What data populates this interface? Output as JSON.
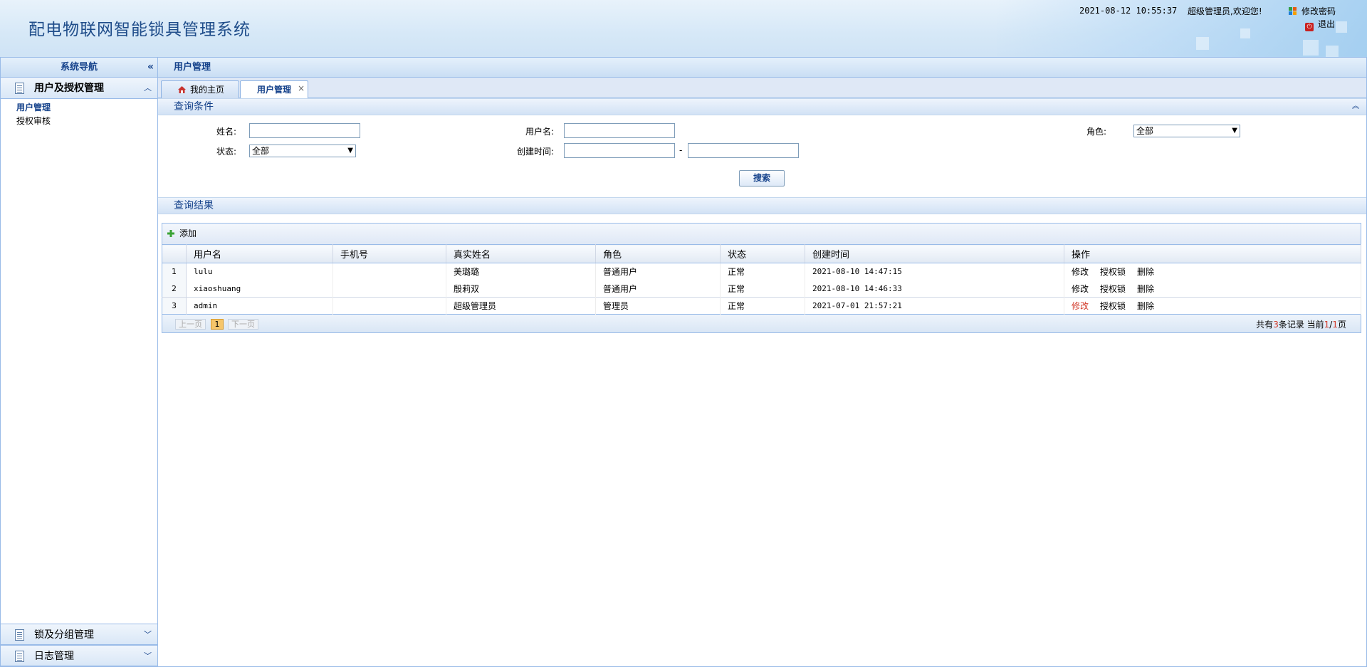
{
  "header": {
    "title": "配电物联网智能锁具管理系统",
    "datetime": "2021-08-12 10:55:37",
    "welcome": "超级管理员,欢迎您!",
    "change_password": "修改密码",
    "logout": "退出"
  },
  "sidebar": {
    "title": "系统导航",
    "collapse_glyph": "«",
    "groups": [
      {
        "label": "用户及授权管理",
        "expanded": true,
        "items": [
          {
            "label": "用户管理",
            "current": true
          },
          {
            "label": "授权审核",
            "current": false
          }
        ]
      },
      {
        "label": "锁及分组管理",
        "expanded": false
      },
      {
        "label": "日志管理",
        "expanded": false
      }
    ]
  },
  "main": {
    "panel_title": "用户管理",
    "tabs": [
      {
        "label": "我的主页",
        "icon": "home-icon",
        "active": false
      },
      {
        "label": "用户管理",
        "active": true,
        "closable": true
      }
    ]
  },
  "query": {
    "section_title": "查询条件",
    "name_label": "姓名:",
    "name_value": "",
    "username_label": "用户名:",
    "username_value": "",
    "role_label": "角色:",
    "role_selected": "全部",
    "status_label": "状态:",
    "status_selected": "全部",
    "created_label": "创建时间:",
    "created_from": "",
    "created_to": "",
    "range_sep": "-",
    "search_button": "搜索"
  },
  "results": {
    "section_title": "查询结果",
    "add_label": "添加",
    "columns": [
      "用户名",
      "手机号",
      "真实姓名",
      "角色",
      "状态",
      "创建时间",
      "操作"
    ],
    "rows": [
      {
        "no": "1",
        "username": "lulu",
        "phone": "",
        "real_name": "美璐璐",
        "role": "普通用户",
        "status": "正常",
        "created": "2021-08-10 14:47:15"
      },
      {
        "no": "2",
        "username": "xiaoshuang",
        "phone": "",
        "real_name": "殷莉双",
        "role": "普通用户",
        "status": "正常",
        "created": "2021-08-10 14:46:33"
      },
      {
        "no": "3",
        "username": "admin",
        "phone": "",
        "real_name": "超级管理员",
        "role": "管理员",
        "status": "正常",
        "created": "2021-07-01 21:57:21"
      }
    ],
    "ops": {
      "edit": "修改",
      "auth_lock": "授权锁",
      "delete": "删除"
    },
    "pager": {
      "prev": "上一页",
      "page": "1",
      "next": "下一页",
      "info_prefix": "共有",
      "total": "3",
      "info_mid": "条记录 当前",
      "current": "1",
      "slash": "/",
      "pages": "1",
      "info_suffix": "页"
    }
  },
  "colors": {
    "accent": "#15428b",
    "border": "#99bbe8",
    "highlight_red": "#d23b2b"
  }
}
